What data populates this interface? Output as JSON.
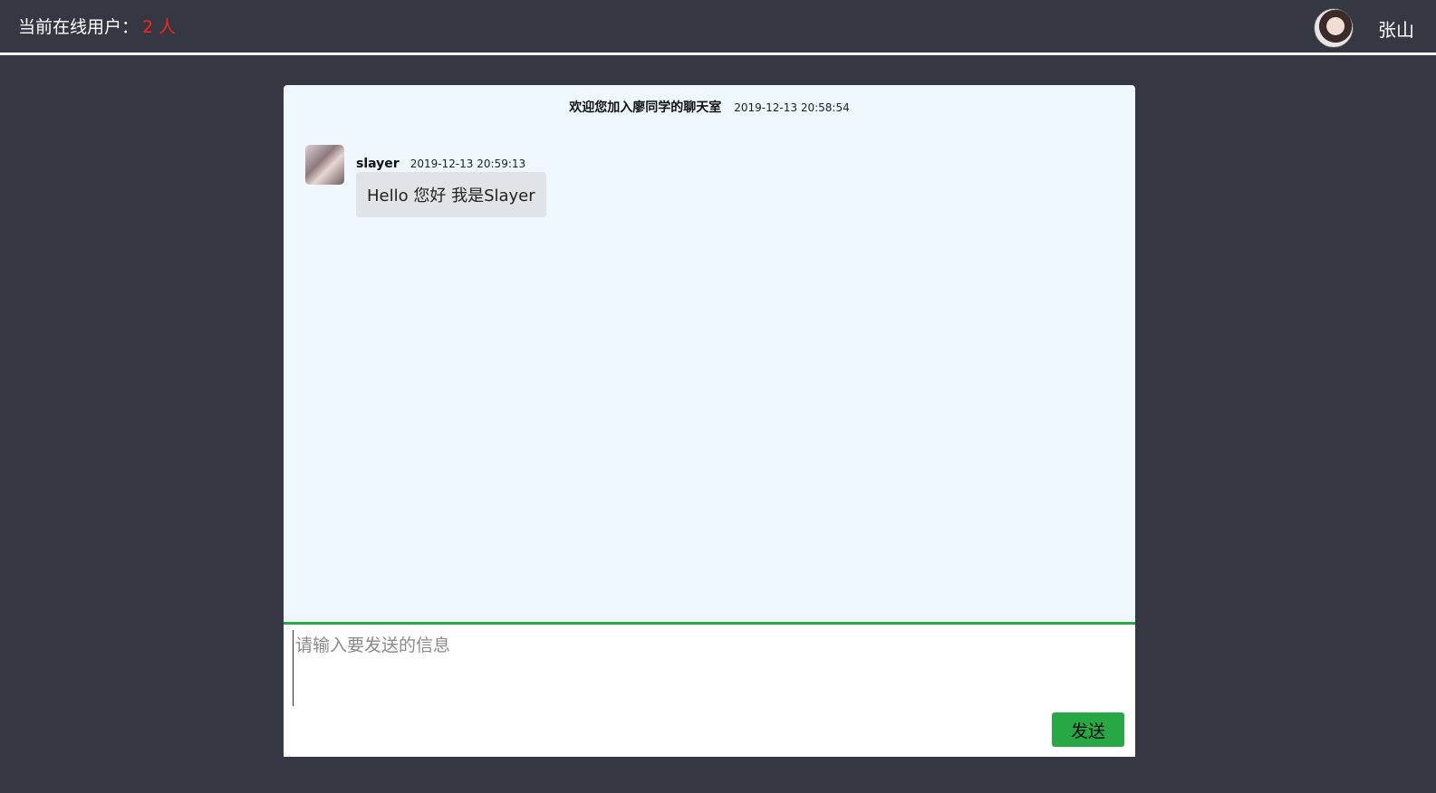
{
  "header": {
    "online_label": "当前在线用户：",
    "online_count": "2 人",
    "username": "张山"
  },
  "chat": {
    "notice_text": "欢迎您加入廖同学的聊天室",
    "notice_time": "2019-12-13 20:58:54",
    "messages": [
      {
        "sender": "slayer",
        "time": "2019-12-13 20:59:13",
        "text": "Hello 您好 我是Slayer"
      }
    ]
  },
  "composer": {
    "placeholder": "请输入要发送的信息",
    "send_label": "发送"
  },
  "colors": {
    "background": "#353843",
    "chat_background": "#eff7ff",
    "accent_green": "#28a745",
    "online_count": "#ff1f1f",
    "bubble": "#e0e3e7"
  }
}
